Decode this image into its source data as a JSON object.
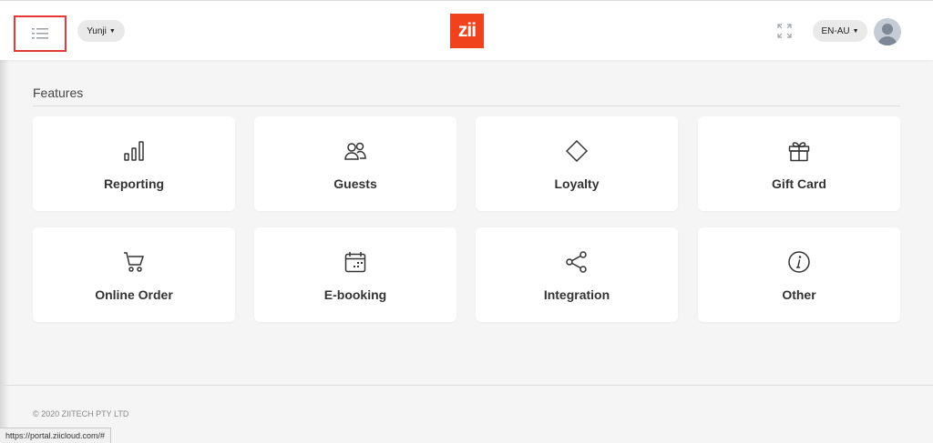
{
  "header": {
    "store_selector": "Yunji",
    "logo_text": "zii",
    "language": "EN-AU",
    "brand_color": "#f0421c"
  },
  "features": {
    "title": "Features",
    "cards": [
      {
        "label": "Reporting",
        "icon": "bar-chart-icon"
      },
      {
        "label": "Guests",
        "icon": "people-icon"
      },
      {
        "label": "Loyalty",
        "icon": "diamond-icon"
      },
      {
        "label": "Gift Card",
        "icon": "gift-icon"
      },
      {
        "label": "Online Order",
        "icon": "cart-icon"
      },
      {
        "label": "E-booking",
        "icon": "calendar-icon"
      },
      {
        "label": "Integration",
        "icon": "share-icon"
      },
      {
        "label": "Other",
        "icon": "info-icon"
      }
    ]
  },
  "footer": {
    "copyright": "© 2020 ZIITECH PTY LTD"
  },
  "status_bar": {
    "url": "https://portal.ziicloud.com/#"
  }
}
